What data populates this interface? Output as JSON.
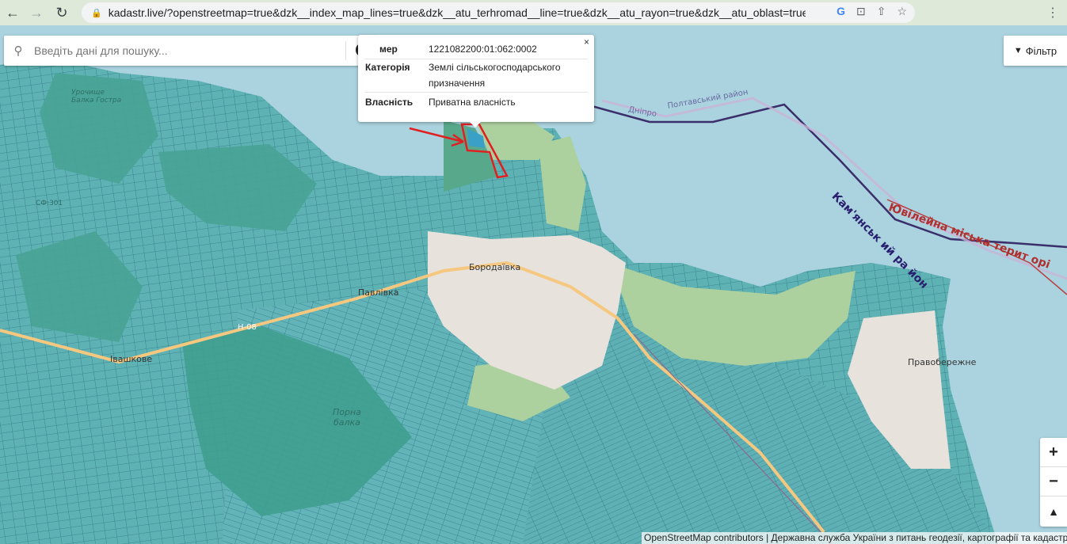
{
  "browser": {
    "back_icon": "arrow-left-icon",
    "forward_icon": "arrow-right-icon",
    "reload_icon": "reload-icon",
    "url": "kadastr.live/?openstreetmap=true&dzk__index_map_lines=true&dzk__atu_terhromad__line=true&dzk__atu_rayon=true&dzk__atu_oblast=true..."
  },
  "search": {
    "placeholder": "Введіть дані для пошуку...",
    "info_glyph": "i"
  },
  "popup": {
    "close": "×",
    "rows": [
      {
        "key": "мер",
        "value": "1221082200:01:062:0002"
      },
      {
        "key": "Категорія",
        "value": "Землі сільськогосподарського призначення"
      },
      {
        "key": "Власність",
        "value": "Приватна власність"
      }
    ]
  },
  "filter": {
    "label": "Фільтр",
    "icon": "filter-icon"
  },
  "zoom": {
    "in": "+",
    "out": "−",
    "north": "▲"
  },
  "map_labels": {
    "borodaivka": "Бородаївка",
    "pavlivka": "Павлівка",
    "ivashkove": "Івашкове",
    "pravoberezhne": "Правобережне",
    "porna_balka": "Порна\nбалка",
    "urochyshche": "Урочище\nБалка Гострa",
    "poltavskyi": "Полтавський район",
    "dnipro": "Дніпро",
    "kamianskyi": "Кам'янськ ий ра  йон",
    "yuvileina": "Ювілейна міська  терит орі",
    "id_code": "СФ:301",
    "road": "Н-08"
  },
  "attribution": "OpenStreetMap contributors | Державна служба України з питань геодезії, картографії та кадастру"
}
